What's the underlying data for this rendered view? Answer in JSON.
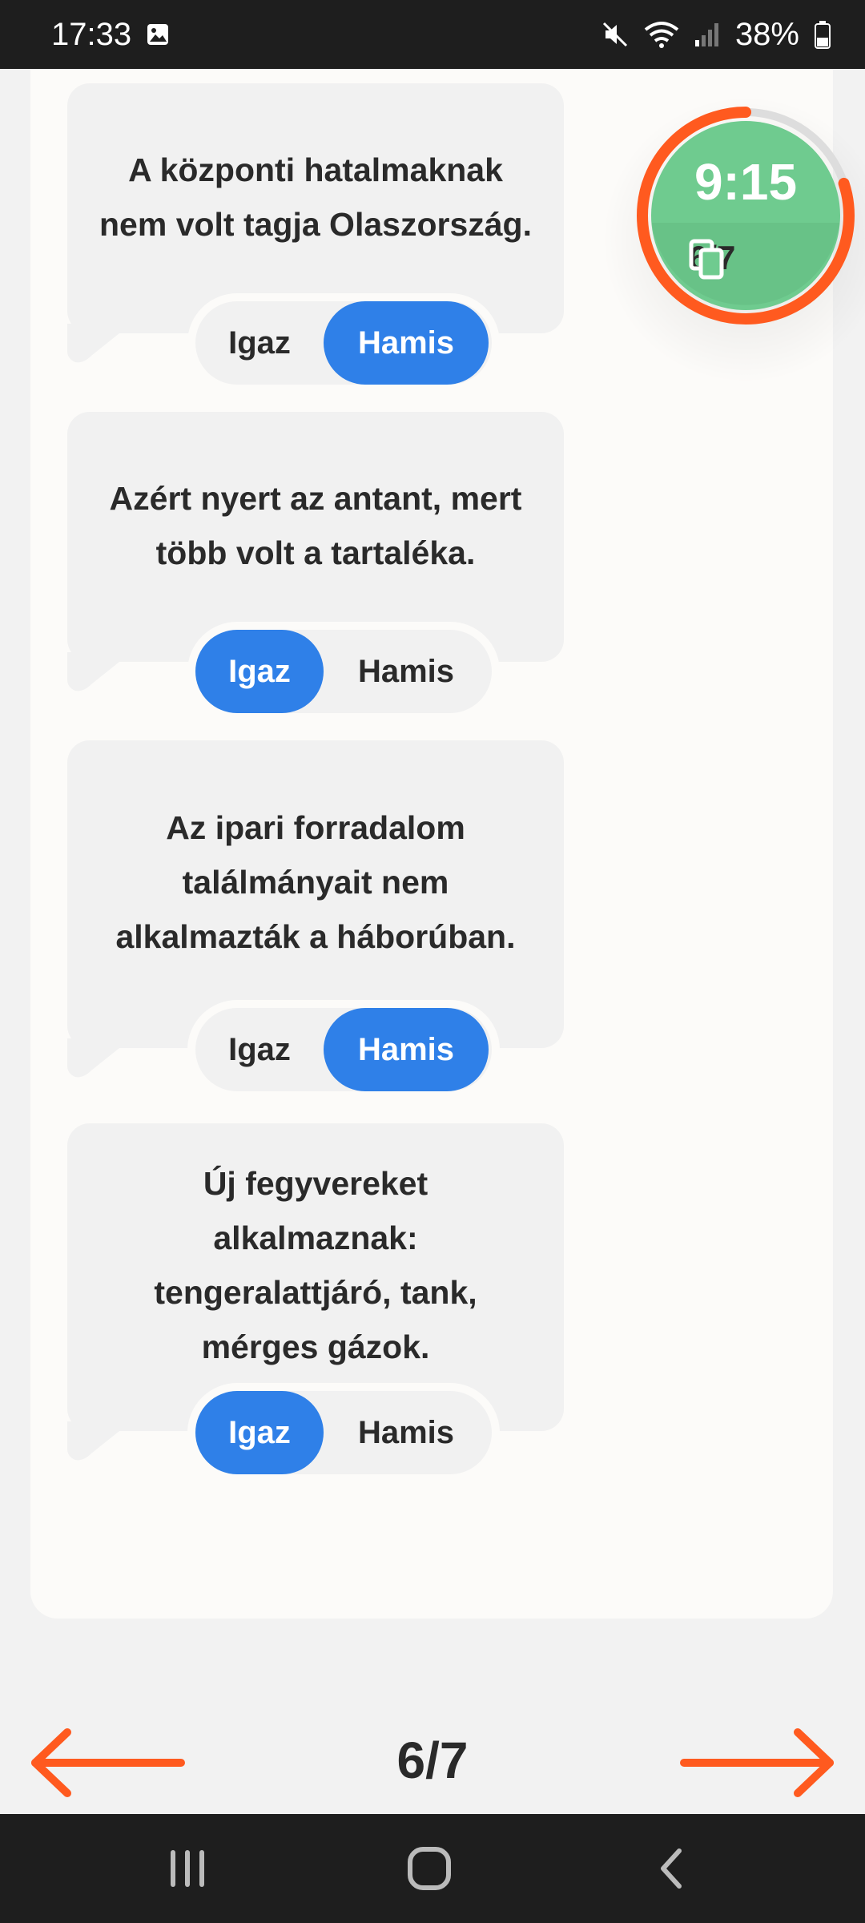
{
  "status_bar": {
    "time": "17:33",
    "battery": "38%",
    "icons": [
      "image-icon",
      "mute-icon",
      "wifi-icon",
      "signal-icon",
      "battery-icon"
    ]
  },
  "timer": {
    "time": "9:15",
    "count": "6/7",
    "remaining_fraction": 0.8,
    "colors": {
      "fill": "#6fcb8f",
      "ring": "#ff5a1f",
      "track": "#dddddd"
    }
  },
  "options": {
    "true_label": "Igaz",
    "false_label": "Hamis"
  },
  "questions": [
    {
      "text": "A központi hatalmaknak nem volt tagja Olaszország.",
      "selected": "Hamis"
    },
    {
      "text": "Azért nyert az antant, mert több volt a tartaléka.",
      "selected": "Igaz"
    },
    {
      "text": "Az ipari forradalom találmányait nem alkalmazták a háborúban.",
      "selected": "Hamis"
    },
    {
      "text": "Új fegyvereket alkalmaznak: tengeralattjáró, tank, mérges gázok.",
      "selected": "Igaz"
    }
  ],
  "pagination": {
    "label": "6/7"
  },
  "colors": {
    "accent": "#2f80e8",
    "arrow": "#ff5a1f",
    "card": "#fcfbf9",
    "bubble": "#f1f1f1"
  },
  "system_nav": {
    "icons": [
      "recent-apps-icon",
      "home-icon",
      "back-icon"
    ]
  }
}
